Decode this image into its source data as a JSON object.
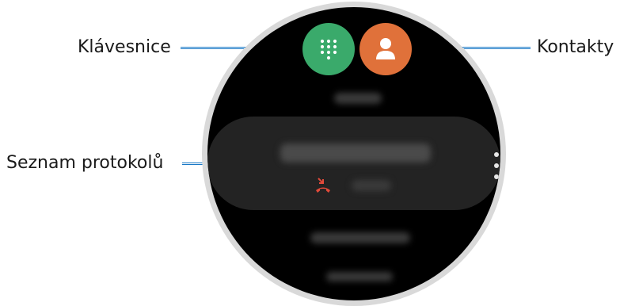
{
  "callouts": {
    "keypad": "Klávesnice",
    "contacts": "Kontakty",
    "logs": "Seznam protokolů"
  },
  "watch": {
    "keypad_icon": "dialpad-icon",
    "contacts_icon": "person-icon",
    "call_status_icon": "missed-call-icon",
    "more_icon": "more-vertical-icon"
  },
  "colors": {
    "keypad_button": "#3aaa6b",
    "contacts_button": "#e0713a",
    "leader_line": "#1a79c6",
    "missed_call": "#e24a3a"
  }
}
